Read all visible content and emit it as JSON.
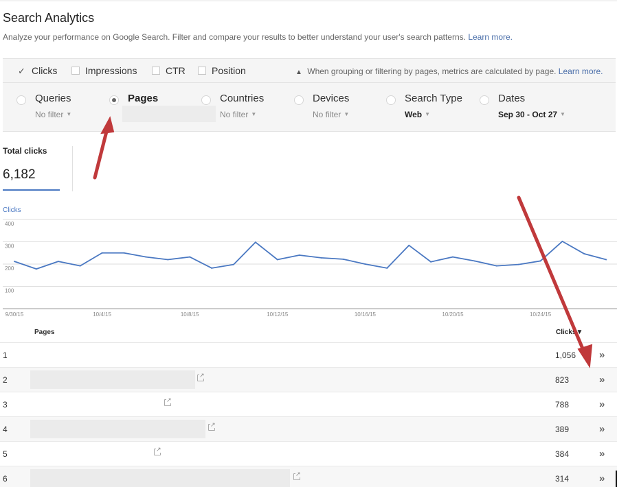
{
  "header": {
    "title": "Search Analytics",
    "description": "Analyze your performance on Google Search. Filter and compare your results to better understand your user's search patterns.",
    "learn_more": "Learn more."
  },
  "metrics": [
    {
      "label": "Clicks",
      "checked": true
    },
    {
      "label": "Impressions",
      "checked": false
    },
    {
      "label": "CTR",
      "checked": false
    },
    {
      "label": "Position",
      "checked": false
    }
  ],
  "notice": {
    "icon": "warning-icon",
    "text": "When grouping or filtering by pages, metrics are calculated by page.",
    "link": "Learn more."
  },
  "groups": [
    {
      "label": "Queries",
      "filter": "No filter",
      "selected": false
    },
    {
      "label": "Pages",
      "filter": "",
      "selected": true
    },
    {
      "label": "Countries",
      "filter": "No filter",
      "selected": false
    },
    {
      "label": "Devices",
      "filter": "No filter",
      "selected": false
    },
    {
      "label": "Search Type",
      "filter": "Web",
      "selected": false
    },
    {
      "label": "Dates",
      "filter": "Sep 30 - Oct 27",
      "selected": false
    }
  ],
  "total": {
    "label": "Total clicks",
    "value": "6,182"
  },
  "chart_data": {
    "type": "line",
    "title": "",
    "legend": "Clicks",
    "xlabel": "",
    "ylabel": "",
    "ylim": [
      0,
      400
    ],
    "yticks": [
      100,
      200,
      300,
      400
    ],
    "grid": true,
    "x": [
      "9/30/15",
      "10/1/15",
      "10/2/15",
      "10/3/15",
      "10/4/15",
      "10/5/15",
      "10/6/15",
      "10/7/15",
      "10/8/15",
      "10/9/15",
      "10/10/15",
      "10/11/15",
      "10/12/15",
      "10/13/15",
      "10/14/15",
      "10/15/15",
      "10/16/15",
      "10/17/15",
      "10/18/15",
      "10/19/15",
      "10/20/15",
      "10/21/15",
      "10/22/15",
      "10/23/15",
      "10/24/15",
      "10/25/15",
      "10/26/15",
      "10/27/15"
    ],
    "xtick_labels": [
      "9/30/15",
      "10/4/15",
      "10/8/15",
      "10/12/15",
      "10/16/15",
      "10/20/15",
      "10/24/15"
    ],
    "series": [
      {
        "name": "Clicks",
        "color": "#4a78c2",
        "values": [
          212,
          178,
          212,
          192,
          250,
          250,
          232,
          220,
          232,
          182,
          198,
          298,
          220,
          240,
          228,
          222,
          200,
          182,
          284,
          210,
          232,
          214,
          192,
          198,
          214,
          302,
          246,
          220
        ]
      }
    ]
  },
  "table": {
    "headers": {
      "pages": "Pages",
      "clicks": "Clicks",
      "sort_indicator": "▼"
    },
    "rows": [
      {
        "rank": "1",
        "clicks": "1,056"
      },
      {
        "rank": "2",
        "clicks": "823"
      },
      {
        "rank": "3",
        "clicks": "788"
      },
      {
        "rank": "4",
        "clicks": "389"
      },
      {
        "rank": "5",
        "clicks": "384"
      },
      {
        "rank": "6",
        "clicks": "314"
      }
    ],
    "row_action": "»"
  },
  "colors": {
    "accent": "#4a78c2",
    "link": "#4a6ea9",
    "annotation_arrow": "#c0393b"
  }
}
